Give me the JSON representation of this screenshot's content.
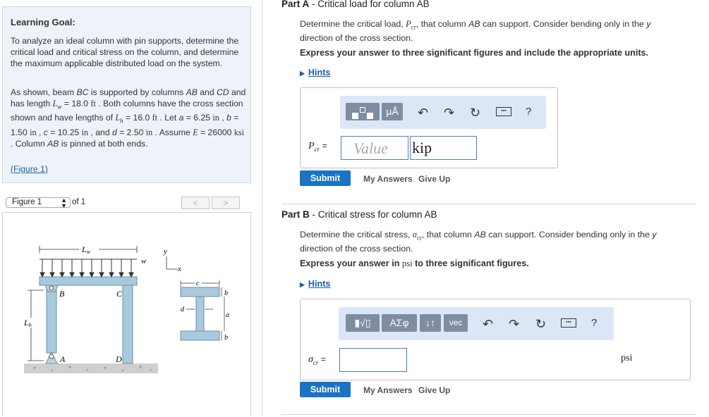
{
  "left": {
    "goal_title": "Learning Goal:",
    "goal_text": "To analyze an ideal column with pin supports, determine the critical load and critical stress on the column, and determine the maximum applicable distributed load on the system.",
    "problem_html": "As shown, beam <i>BC</i> is supported by columns <i>AB</i> and <i>CD</i> and has length <span class='serif'><i>L</i><sub style='font-size:9px'><i>w</i></sub></span> = 18.0 <span class='serif'>ft</span> . Both columns have the cross section shown and have lengths of <span class='serif'><i>L</i><sub style='font-size:9px'><i>h</i></sub></span> = 16.0 <span class='serif'>ft</span> . Let <i>a</i> = 6.25 <span class='serif'>in</span> , <i>b</i> = 1.50 <span class='serif'>in</span> , <i>c</i> = 10.25 <span class='serif'>in</span> , and <i>d</i> = 2.50 <span class='serif'>in</span> . Assume <span class='serif'><i>E</i></span> = 26000 <span class='serif'>ksi</span> . Column <i>AB</i> is pinned at both ends.",
    "figure_link": "(Figure 1)",
    "figure_select": "Figure 1",
    "figure_of": "of 1",
    "prev": "<",
    "next": ">"
  },
  "figure": {
    "Lw": "L",
    "Lw_sub": "w",
    "Lh": "L",
    "Lh_sub": "h",
    "w": "w",
    "B": "B",
    "C": "C",
    "A": "A",
    "D": "D",
    "y": "y",
    "x": "x",
    "c": "c",
    "d": "d",
    "a": "a",
    "b_top": "b",
    "b_bot": "b"
  },
  "partA": {
    "title_bold": "Part A",
    "title_rest": " - Critical load for column AB",
    "question_html": "Determine the critical load, <span class='serif'><i>P</i><sub style='font-size:9px'>cr</sub></span>, that column <i>AB</i> can support. Consider bending only in the <i>y</i> direction of the cross section.",
    "instruction": "Express your answer to three significant figures and include the appropriate units.",
    "hints": "Hints",
    "var_label": "P",
    "var_sub": "cr",
    "equals": "=",
    "value_placeholder": "Value",
    "units_value": "kip",
    "mu_label": "μÅ",
    "help": "?",
    "submit": "Submit",
    "my_answers": "My Answers",
    "give_up": "Give Up"
  },
  "partB": {
    "title_bold": "Part B",
    "title_rest": " - Critical stress for column AB",
    "question_html": "Determine the critical stress, <span class='serif'><i>σ</i><sub style='font-size:9px'>cr</sub></span>, that column <i>AB</i> can support. Consider bending only in the <i>y</i> direction of the cross section.",
    "instruction_pre": "Express your answer in ",
    "instruction_unit": "psi",
    "instruction_post": " to three significant figures.",
    "hints": "Hints",
    "var_label": "σ",
    "var_sub": "cr",
    "equals": "=",
    "greek_label": "ΑΣφ",
    "arrows_label": "↓↑",
    "vec_label": "vec",
    "help": "?",
    "unit": "psi",
    "submit": "Submit",
    "my_answers": "My Answers",
    "give_up": "Give Up"
  },
  "colors": {
    "accent": "#1a73c4",
    "link": "#1b5ea8",
    "toolbar": "#dbe7f6",
    "goal_bg": "#eef3fa"
  }
}
